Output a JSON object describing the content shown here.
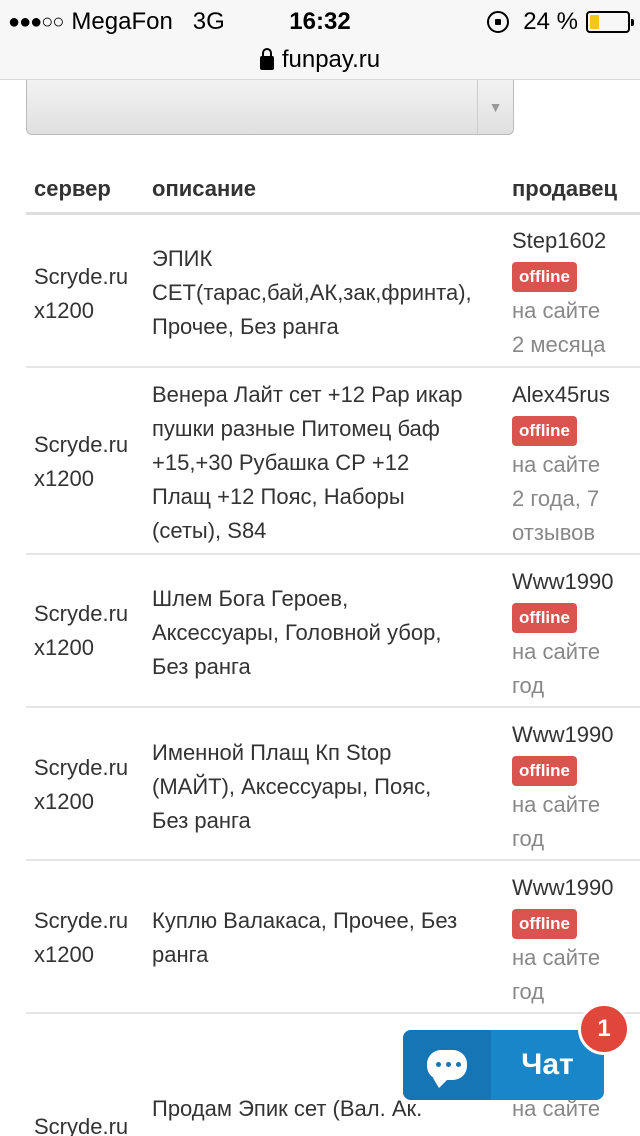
{
  "status": {
    "carrier": "MegaFon",
    "network": "3G",
    "time": "16:32",
    "battery": "24 %",
    "battery_level": 0.24
  },
  "url": "funpay.ru",
  "table": {
    "headers": {
      "server": "сервер",
      "description": "описание",
      "seller": "продавец"
    },
    "rows": [
      {
        "server_line1": "Scryde.ru",
        "server_line2": "x1200",
        "description": [
          "ЭПИК",
          "СЕТ(тарас,бай,АК,зак,фринта),",
          "Прочее, Без ранга"
        ],
        "seller": "Step1602",
        "status": "offline",
        "meta": [
          "на сайте",
          "2 месяца"
        ]
      },
      {
        "server_line1": "Scryde.ru",
        "server_line2": "x1200",
        "description": [
          "Венера Лайт сет +12 Рар икар",
          "пушки разные Питомец баф",
          "+15,+30 Рубашка СР +12",
          "Плащ +12 Пояс, Наборы",
          "(сеты), S84"
        ],
        "seller": "Alex45rus",
        "status": "offline",
        "meta": [
          "на сайте",
          "2 года, 7",
          "отзывов"
        ]
      },
      {
        "server_line1": "Scryde.ru",
        "server_line2": "x1200",
        "description": [
          "Шлем Бога Героев,",
          "Аксессуары, Головной убор,",
          "Без ранга"
        ],
        "seller": "Www1990",
        "status": "offline",
        "meta": [
          "на сайте",
          "год"
        ]
      },
      {
        "server_line1": "Scryde.ru",
        "server_line2": "x1200",
        "description": [
          "Именной Плащ Кп Stop",
          "(МАЙТ), Аксессуары, Пояс,",
          "Без ранга"
        ],
        "seller": "Www1990",
        "status": "offline",
        "meta": [
          "на сайте",
          "год"
        ]
      },
      {
        "server_line1": "Scryde.ru",
        "server_line2": "x1200",
        "description": [
          "Куплю Валакаса, Прочее, Без",
          "ранга"
        ],
        "seller": "Www1990",
        "status": "offline",
        "meta": [
          "на сайте",
          "год"
        ]
      },
      {
        "server_line1": "Scryde.ru",
        "server_line2": "",
        "description": [
          "Продам Эпик сет (Вал. Ак."
        ],
        "seller": "",
        "status": "",
        "meta": [
          "на сайте"
        ]
      }
    ]
  },
  "chat": {
    "label": "Чат",
    "badge": "1"
  },
  "colors": {
    "offline_badge": "#d9534f",
    "chat": "#1886c8",
    "chat_badge": "#e0463a"
  }
}
